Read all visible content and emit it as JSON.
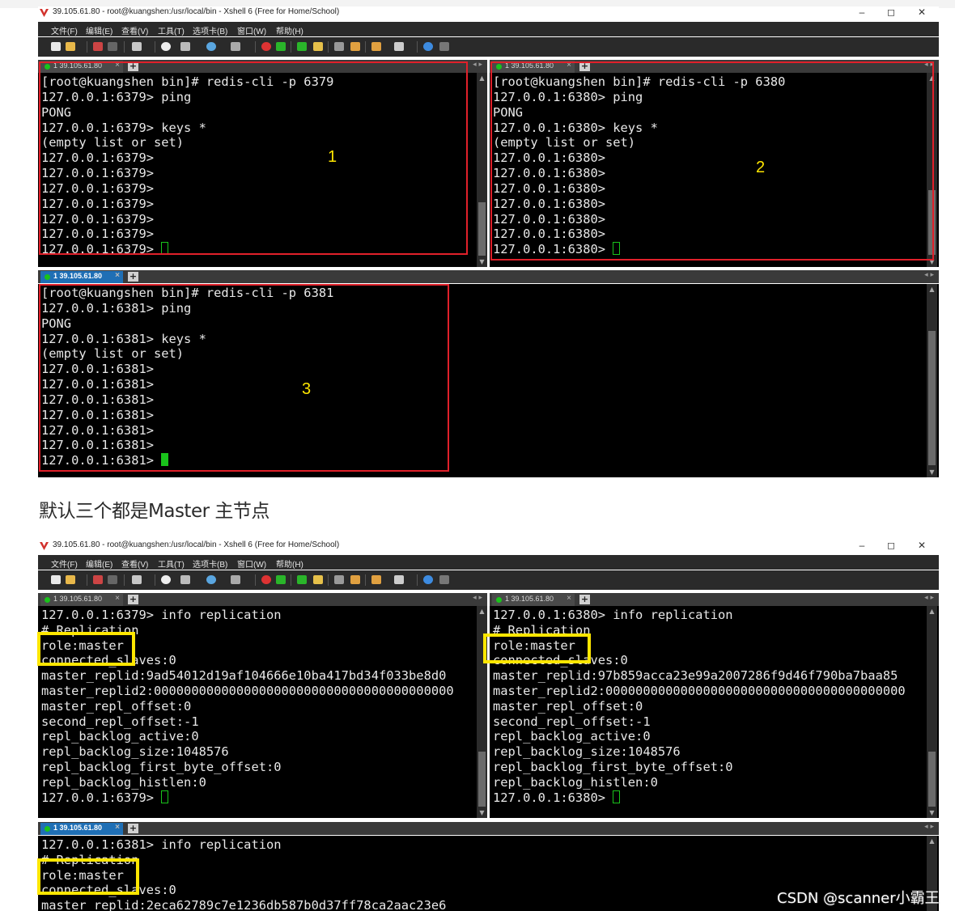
{
  "window": {
    "title": "39.105.61.80 - root@kuangshen:/usr/local/bin - Xshell 6 (Free for Home/School)",
    "controls": [
      "–",
      "◻",
      "✕"
    ]
  },
  "menu": [
    "文件(F)",
    "编辑(E)",
    "查看(V)",
    "工具(T)",
    "选项卡(B)",
    "窗口(W)",
    "帮助(H)"
  ],
  "tab_label": "1 39.105.61.80",
  "tab_close": "×",
  "tab_add": "+",
  "tab_nav": "◂ ▸",
  "shot1": {
    "pane1": [
      "[root@kuangshen bin]# redis-cli -p 6379",
      "127.0.0.1:6379> ping",
      "PONG",
      "127.0.0.1:6379> keys *",
      "(empty list or set)",
      "127.0.0.1:6379>",
      "127.0.0.1:6379>",
      "127.0.0.1:6379>",
      "127.0.0.1:6379>",
      "127.0.0.1:6379>",
      "127.0.0.1:6379>",
      "127.0.0.1:6379> "
    ],
    "pane2": [
      "[root@kuangshen bin]# redis-cli -p 6380",
      "127.0.0.1:6380> ping",
      "PONG",
      "127.0.0.1:6380> keys *",
      "(empty list or set)",
      "127.0.0.1:6380>",
      "127.0.0.1:6380>",
      "127.0.0.1:6380>",
      "127.0.0.1:6380>",
      "127.0.0.1:6380>",
      "127.0.0.1:6380>",
      "127.0.0.1:6380> "
    ],
    "pane3": [
      "[root@kuangshen bin]# redis-cli -p 6381",
      "127.0.0.1:6381> ping",
      "PONG",
      "127.0.0.1:6381> keys *",
      "(empty list or set)",
      "127.0.0.1:6381>",
      "127.0.0.1:6381>",
      "127.0.0.1:6381>",
      "127.0.0.1:6381>",
      "127.0.0.1:6381>",
      "127.0.0.1:6381>",
      "127.0.0.1:6381> "
    ],
    "marks": [
      "1",
      "2",
      "3"
    ]
  },
  "caption": "默认三个都是Master 主节点",
  "shot2": {
    "pane1": [
      "127.0.0.1:6379> info replication",
      "# Replication",
      "role:master",
      "connected_slaves:0",
      "master_replid:9ad54012d19af104666e10ba417bd34f033be8d0",
      "master_replid2:0000000000000000000000000000000000000000",
      "master_repl_offset:0",
      "second_repl_offset:-1",
      "repl_backlog_active:0",
      "repl_backlog_size:1048576",
      "repl_backlog_first_byte_offset:0",
      "repl_backlog_histlen:0",
      "127.0.0.1:6379> "
    ],
    "pane2": [
      "127.0.0.1:6380> info replication",
      "# Replication",
      "role:master",
      "connected_slaves:0",
      "master_replid:97b859acca23e99a2007286f9d46f790ba7baa85",
      "master_replid2:0000000000000000000000000000000000000000",
      "master_repl_offset:0",
      "second_repl_offset:-1",
      "repl_backlog_active:0",
      "repl_backlog_size:1048576",
      "repl_backlog_first_byte_offset:0",
      "repl_backlog_histlen:0",
      "127.0.0.1:6380> "
    ],
    "pane3": [
      "127.0.0.1:6381> info replication",
      "# Replication",
      "role:master",
      "connected_slaves:0",
      "master_replid:2eca62789c7e1236db587b0d37ff78ca2aac23e6"
    ]
  },
  "watermark": "CSDN @scanner小霸王",
  "colors": {
    "red_box": "#e0202a",
    "yellow_box": "#ffe600",
    "cursor": "#19c31b",
    "tab_active": "#1f6fb5"
  }
}
